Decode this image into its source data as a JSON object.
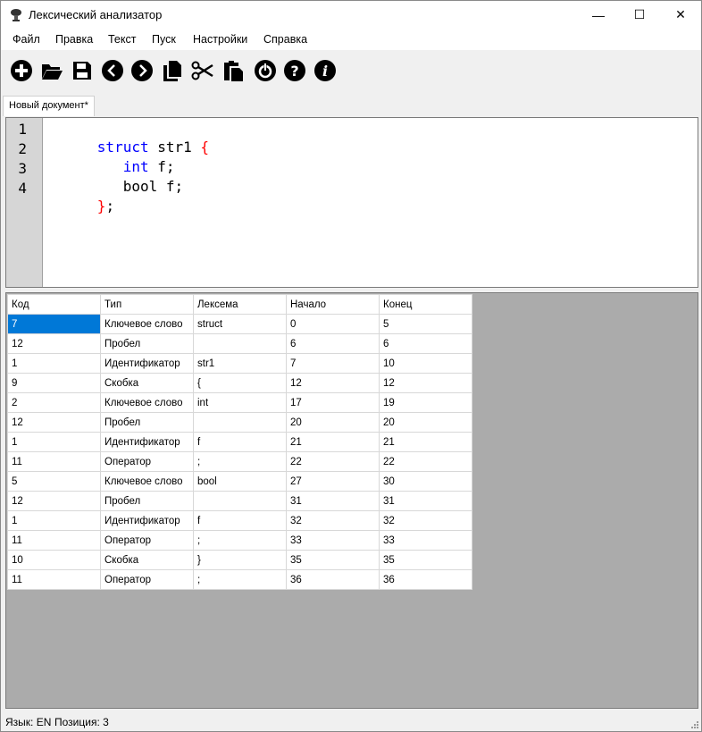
{
  "window": {
    "title": "Лексический анализатор",
    "controls": {
      "minimize": "—",
      "maximize": "☐",
      "close": "✕"
    }
  },
  "menu": [
    "Файл",
    "Правка",
    "Текст",
    "Пуск",
    "Настройки",
    "Справка"
  ],
  "toolbar": [
    {
      "icon": "new-icon"
    },
    {
      "icon": "open-folder-icon"
    },
    {
      "icon": "save-icon"
    },
    {
      "icon": "undo-icon"
    },
    {
      "icon": "redo-icon"
    },
    {
      "icon": "copy-icon"
    },
    {
      "icon": "cut-icon"
    },
    {
      "icon": "paste-icon"
    },
    {
      "icon": "run-icon"
    },
    {
      "icon": "help-icon"
    },
    {
      "icon": "info-icon"
    }
  ],
  "tabs": [
    {
      "label": "Новый документ*"
    }
  ],
  "editor": {
    "line_numbers": [
      "1",
      "2",
      "3",
      "4"
    ],
    "lines": [
      [
        {
          "text": "struct",
          "color": "#0000ff"
        },
        {
          "text": " str1 ",
          "color": "#000000"
        },
        {
          "text": "{",
          "color": "#ff0000"
        }
      ],
      [
        {
          "text": "   ",
          "color": "#000000"
        },
        {
          "text": "int",
          "color": "#0000ff"
        },
        {
          "text": " f;",
          "color": "#000000"
        }
      ],
      [
        {
          "text": "   bool f;",
          "color": "#000000"
        }
      ],
      [
        {
          "text": "}",
          "color": "#ff0000"
        },
        {
          "text": ";",
          "color": "#000000"
        }
      ]
    ]
  },
  "table": {
    "columns": [
      "Код",
      "Тип",
      "Лексема",
      "Начало",
      "Конец"
    ],
    "rows": [
      [
        "7",
        "Ключевое слово",
        "struct",
        "0",
        "5"
      ],
      [
        "12",
        "Пробел",
        "",
        "6",
        "6"
      ],
      [
        "1",
        "Идентификатор",
        "str1",
        "7",
        "10"
      ],
      [
        "9",
        "Скобка",
        "{",
        "12",
        "12"
      ],
      [
        "2",
        "Ключевое слово",
        "int",
        "17",
        "19"
      ],
      [
        "12",
        "Пробел",
        "",
        "20",
        "20"
      ],
      [
        "1",
        "Идентификатор",
        "f",
        "21",
        "21"
      ],
      [
        "11",
        "Оператор",
        ";",
        "22",
        "22"
      ],
      [
        "5",
        "Ключевое слово",
        "bool",
        "27",
        "30"
      ],
      [
        "12",
        "Пробел",
        "",
        "31",
        "31"
      ],
      [
        "1",
        "Идентификатор",
        "f",
        "32",
        "32"
      ],
      [
        "11",
        "Оператор",
        ";",
        "33",
        "33"
      ],
      [
        "10",
        "Скобка",
        "}",
        "35",
        "35"
      ],
      [
        "11",
        "Оператор",
        ";",
        "36",
        "36"
      ]
    ]
  },
  "status": {
    "language": "Язык: EN",
    "position": "Позиция: 3"
  },
  "colors": {
    "keyword": "#0000ff",
    "brace": "#ff0000",
    "selection": "#0078d7",
    "grid_background": "#ababab"
  }
}
